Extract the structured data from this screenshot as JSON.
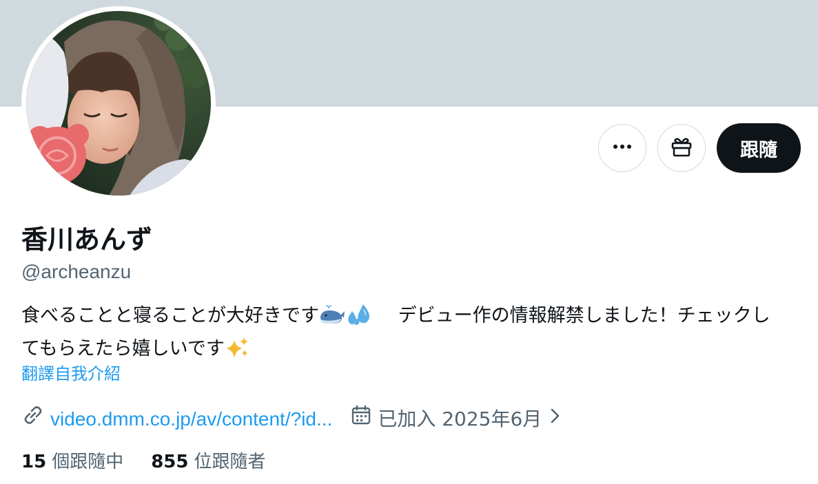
{
  "profile": {
    "display_name": "香川あんず",
    "handle": "@archeanzu",
    "bio_line1_text": "食べることと寝ることが大好きです",
    "bio_emojis_1": [
      "whale-emoji",
      "sweat-droplets-emoji"
    ],
    "bio_line1_rest": "デビュー作の情報解禁しました！チェックし",
    "bio_line2_text": "てもらえたら嬉しいです",
    "bio_emojis_2": [
      "sparkles-emoji"
    ],
    "translate_label": "翻譯自我介紹",
    "website": "video.dmm.co.jp/av/content/?id...",
    "joined": "已加入 2025年6月"
  },
  "actions": {
    "more_icon": "more-icon",
    "gift_icon": "gift-icon",
    "follow_label": "跟隨"
  },
  "stats": {
    "following_count": "15",
    "following_label": "個跟隨中",
    "followers_count": "855",
    "followers_label": "位跟隨者"
  },
  "colors": {
    "banner": "#cfd9de",
    "link": "#1d9bf0",
    "secondary_text": "#536471",
    "primary_text": "#0f1419",
    "follow_button": "#0f1419"
  }
}
